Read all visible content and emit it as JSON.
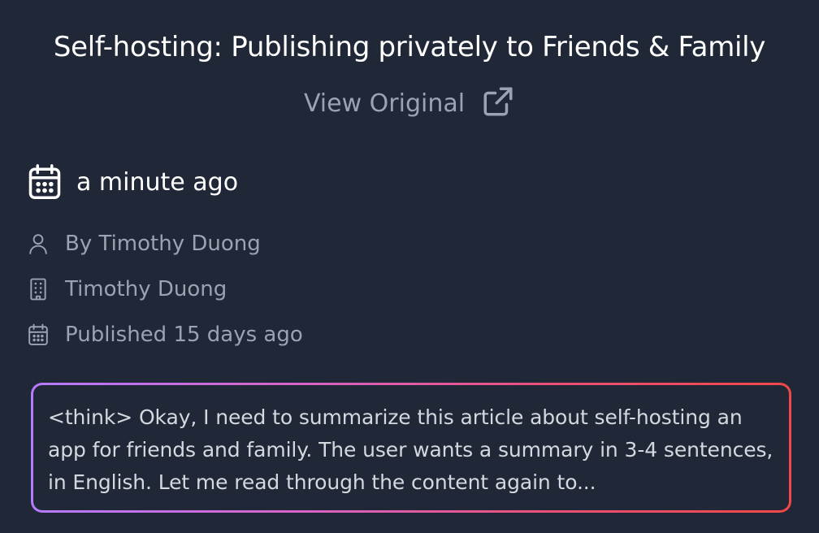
{
  "article": {
    "title": "Self-hosting: Publishing privately to Friends & Family",
    "view_original_label": "View Original",
    "saved_time": "a minute ago",
    "author": "By Timothy Duong",
    "site_name": "Timothy Duong",
    "published": "Published 15 days ago"
  },
  "summary": {
    "text": "<think> Okay, I need to summarize this article about self-hosting an app for friends and family. The user wants a summary in 3-4 sentences, in English. Let me read through the content again to..."
  },
  "icons": {
    "external_link": "external-link-icon",
    "calendar": "calendar-icon",
    "user": "user-icon",
    "building": "building-icon"
  },
  "colors": {
    "background": "#202737",
    "muted_text": "#9aa3b2",
    "gradient_start": "#b57bff",
    "gradient_end": "#f04848"
  }
}
